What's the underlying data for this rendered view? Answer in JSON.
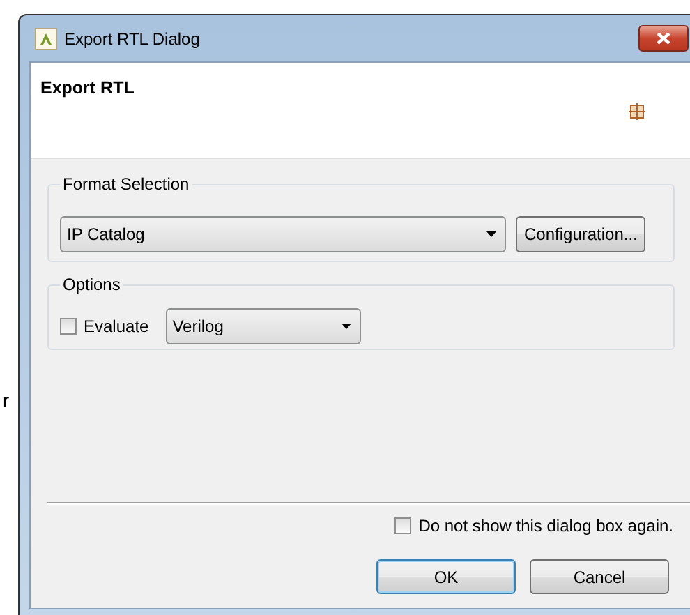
{
  "background_text": "r",
  "window": {
    "title": "Export RTL Dialog"
  },
  "header": {
    "title": "Export RTL"
  },
  "format_selection": {
    "label": "Format Selection",
    "format": {
      "value": "IP Catalog"
    },
    "configuration_button": "Configuration..."
  },
  "options": {
    "label": "Options",
    "evaluate": {
      "label": "Evaluate",
      "checked": false
    },
    "language": {
      "value": "Verilog"
    }
  },
  "dont_show_again": {
    "label": "Do not show this dialog box again.",
    "checked": false
  },
  "buttons": [
    {
      "label": "OK",
      "default": true
    },
    {
      "label": "Cancel",
      "default": false
    }
  ]
}
